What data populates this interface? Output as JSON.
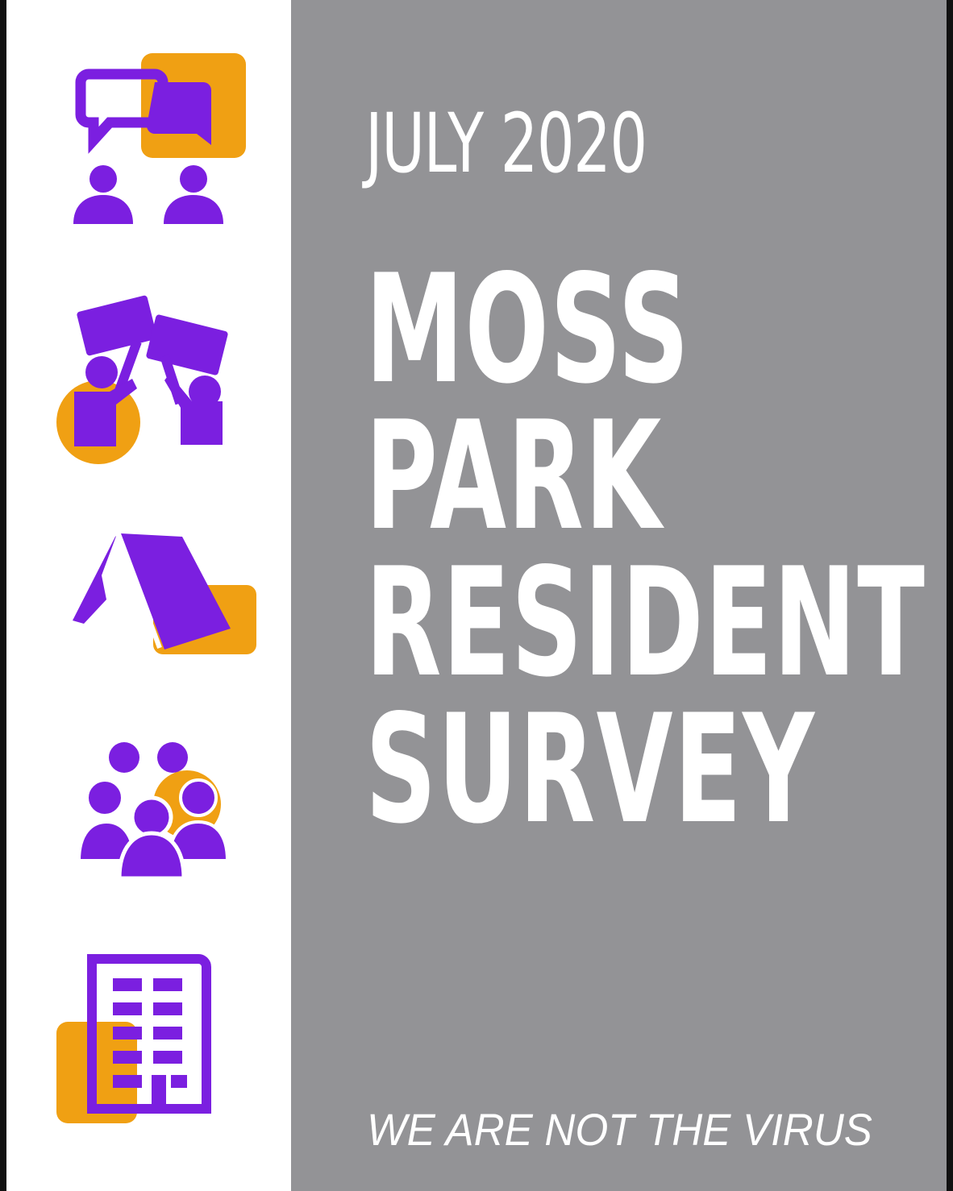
{
  "cover": {
    "date": "JULY 2020",
    "title_lines": [
      "MOSS",
      "PARK",
      "RESIDENT",
      "SURVEY"
    ],
    "tagline": "WE ARE NOT THE VIRUS"
  },
  "icons": [
    "conversation-icon",
    "protest-signs-icon",
    "tent-icon",
    "crowd-icon",
    "building-icon"
  ],
  "colors": {
    "purple": "#7b1fe0",
    "orange": "#f0a013",
    "panel_gray": "#939396",
    "text": "#ffffff",
    "icon_column_bg": "#ffffff"
  }
}
